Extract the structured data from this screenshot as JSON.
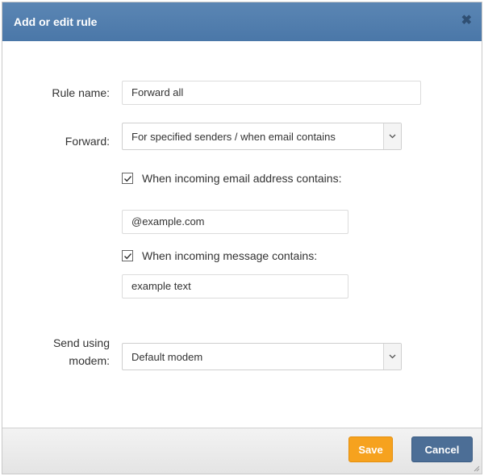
{
  "dialog": {
    "title": "Add or edit rule",
    "close_symbol": "✖"
  },
  "fields": {
    "rule_name_label": "Rule name:",
    "rule_name_value": "Forward all",
    "forward_label": "Forward:",
    "forward_value": "For specified senders / when email contains",
    "email_address_check_label": "When incoming email address contains:",
    "email_address_checked": true,
    "email_address_value": "@example.com",
    "message_check_label": "When incoming message contains:",
    "message_checked": true,
    "message_value": "example text",
    "modem_label_line1": "Send using",
    "modem_label_line2": "modem:",
    "modem_value": "Default modem"
  },
  "buttons": {
    "save": "Save",
    "cancel": "Cancel"
  },
  "colors": {
    "titlebar": "#4a77a8",
    "save": "#f6a21e",
    "cancel": "#4c6e96"
  }
}
